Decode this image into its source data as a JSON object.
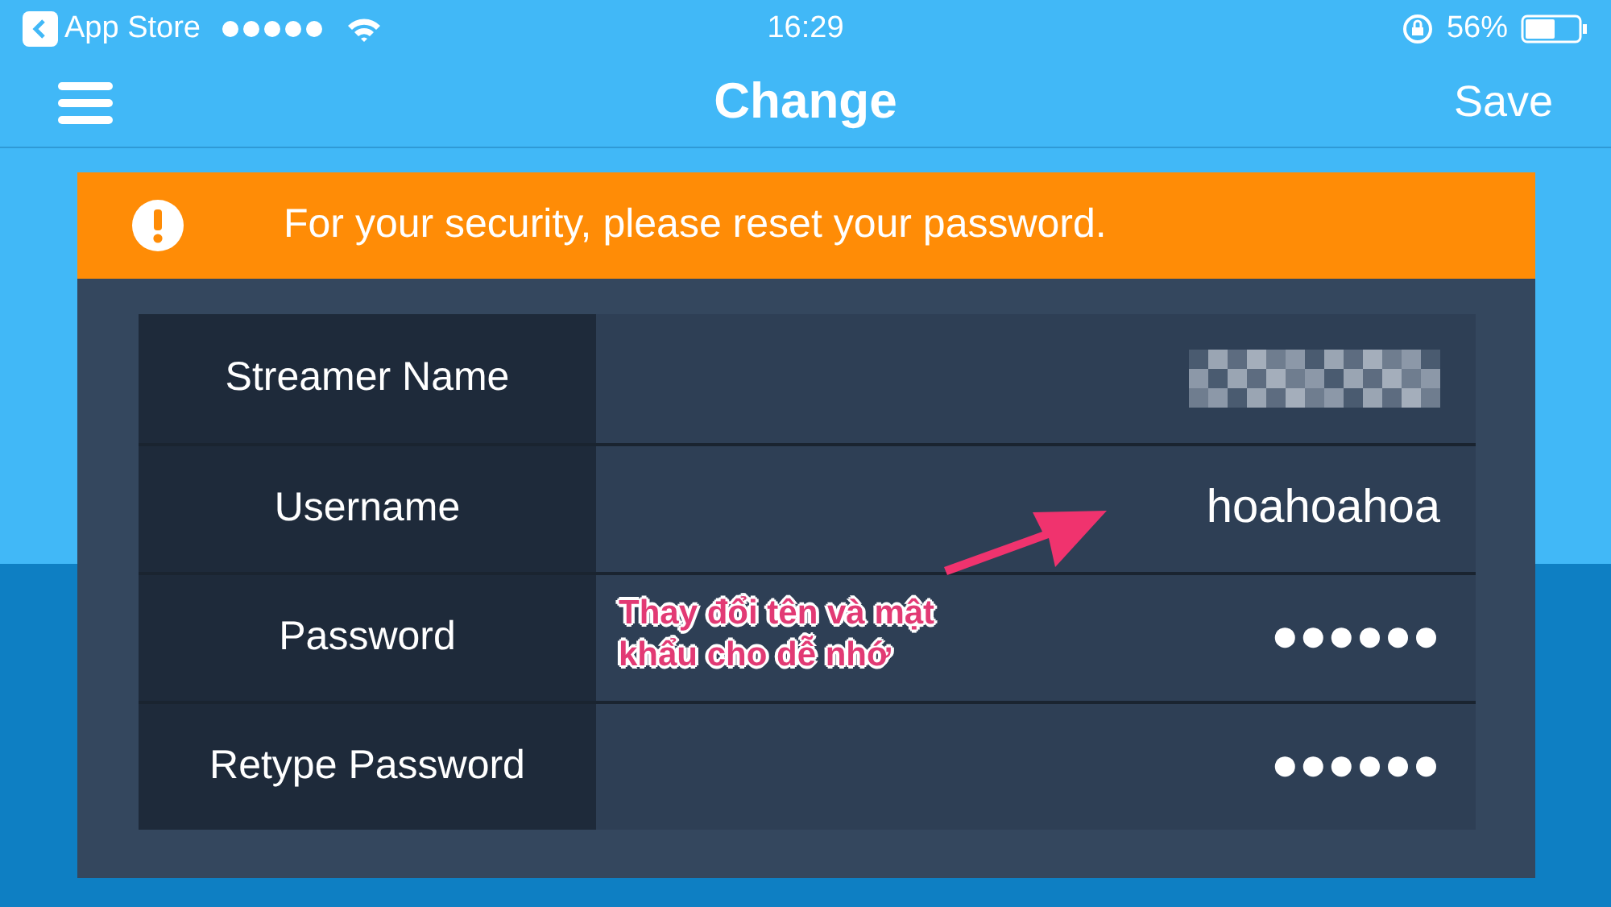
{
  "status_bar": {
    "back_app": "App Store",
    "time": "16:29",
    "battery": "56%"
  },
  "nav": {
    "title": "Change",
    "action": "Save"
  },
  "banner": {
    "text": "For your security, please reset your password."
  },
  "fields": [
    {
      "label": "Streamer Name",
      "kind": "blurred"
    },
    {
      "label": "Username",
      "kind": "text",
      "value": "hoahoahoa"
    },
    {
      "label": "Password",
      "kind": "text",
      "value": "●●●●●●"
    },
    {
      "label": "Retype Password",
      "kind": "text",
      "value": "●●●●●●"
    }
  ],
  "annotation": {
    "text": "Thay đổi tên và mật khẩu cho dễ nhớ"
  }
}
